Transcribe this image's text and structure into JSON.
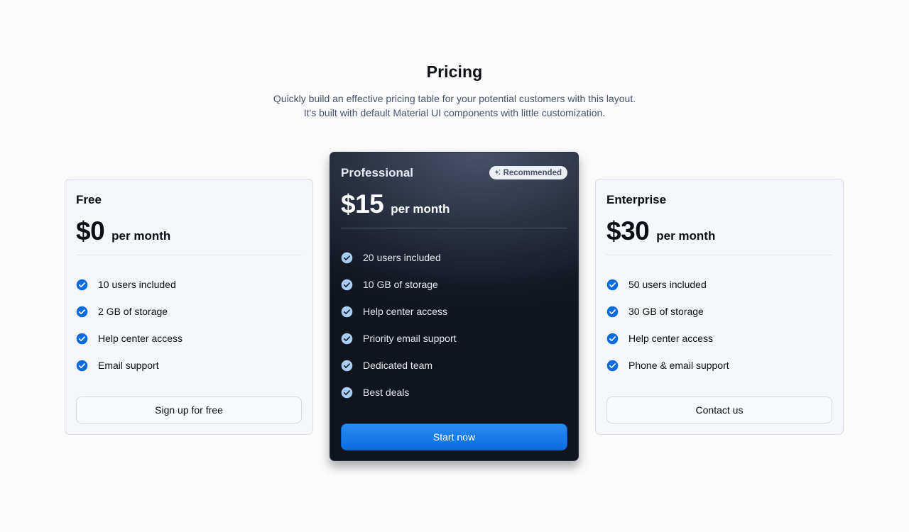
{
  "header": {
    "title": "Pricing",
    "subtitle_line1": "Quickly build an effective pricing table for your potential customers with this layout.",
    "subtitle_line2": "It's built with default Material UI components with little customization."
  },
  "colors": {
    "accent_blue": "#0b6bde",
    "check_light": "#0b6bde",
    "check_dark": "#a8cdf6",
    "dark_card": "#141a24"
  },
  "plans": [
    {
      "name": "Free",
      "price": "$0",
      "period": "per month",
      "features": [
        "10 users included",
        "2 GB of storage",
        "Help center access",
        "Email support"
      ],
      "button_label": "Sign up for free"
    },
    {
      "name": "Professional",
      "badge": "Recommended",
      "badge_icon": "sparkle-icon",
      "price": "$15",
      "period": "per month",
      "features": [
        "20 users included",
        "10 GB of storage",
        "Help center access",
        "Priority email support",
        "Dedicated team",
        "Best deals"
      ],
      "button_label": "Start now"
    },
    {
      "name": "Enterprise",
      "price": "$30",
      "period": "per month",
      "features": [
        "50 users included",
        "30 GB of storage",
        "Help center access",
        "Phone & email support"
      ],
      "button_label": "Contact us"
    }
  ]
}
